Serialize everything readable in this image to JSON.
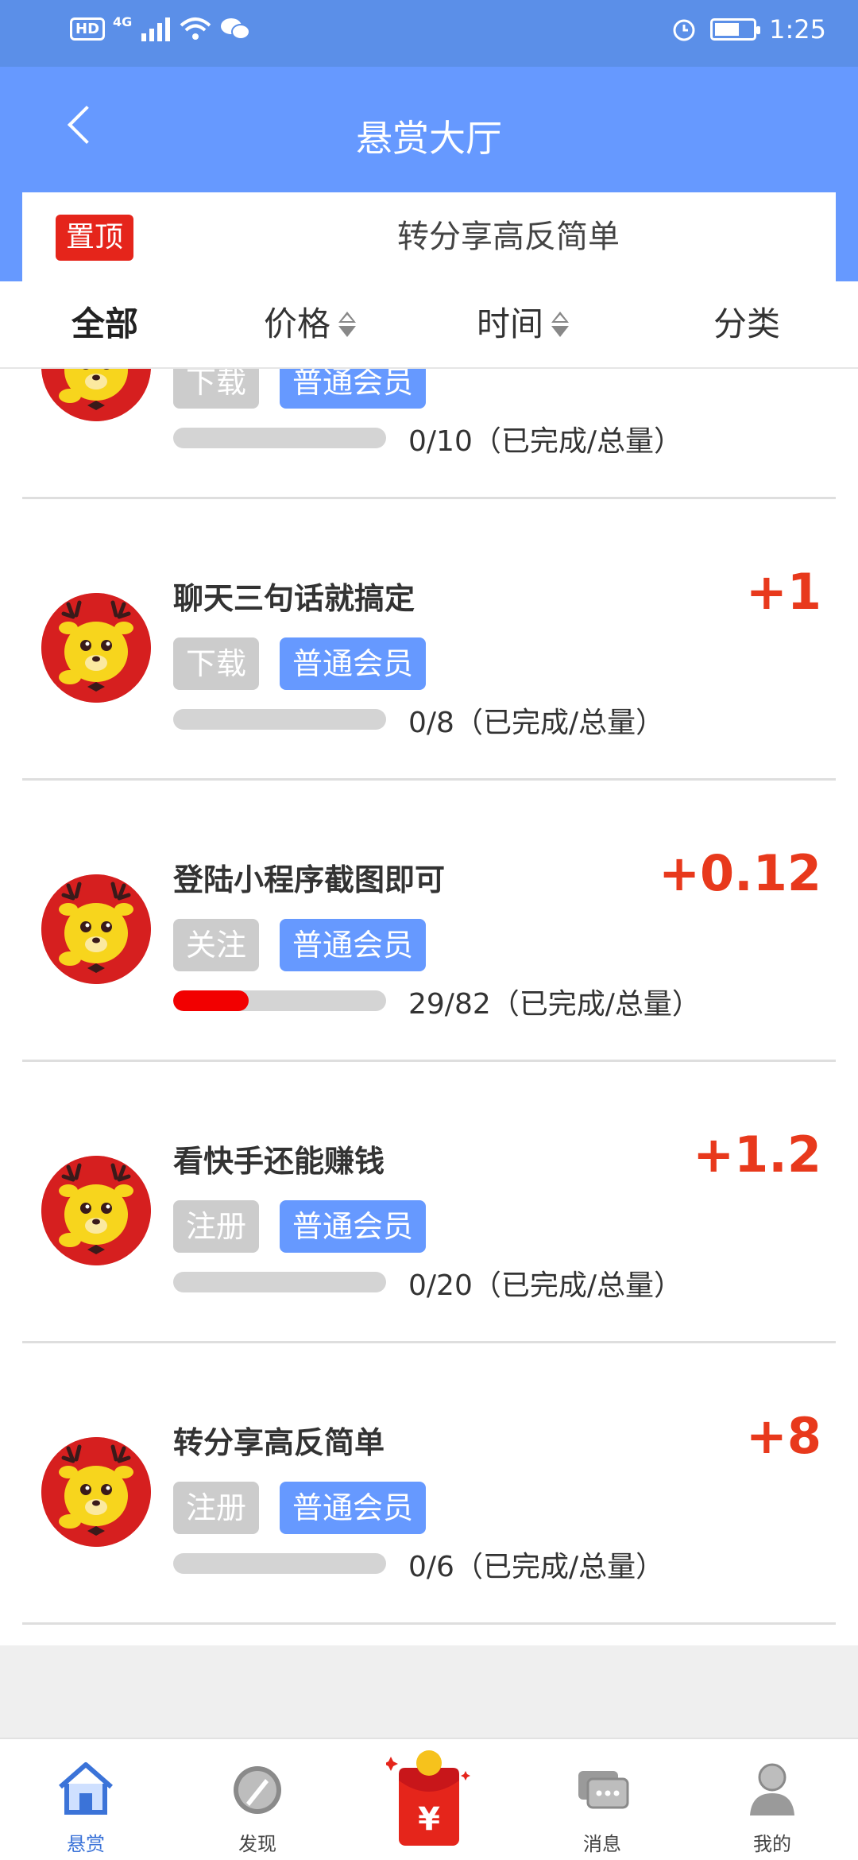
{
  "status_bar": {
    "time": "1:25",
    "network": "4G",
    "hd": "HD"
  },
  "header": {
    "title": "悬赏大厅"
  },
  "banner": {
    "pin_label": "置顶",
    "text": "转分享高反简单"
  },
  "filters": [
    {
      "label": "全部",
      "active": true
    },
    {
      "label": "价格",
      "sortable": true
    },
    {
      "label": "时间",
      "sortable": true
    },
    {
      "label": "分类"
    }
  ],
  "tasks": [
    {
      "title": "",
      "reward": "",
      "tags": [
        "下载",
        "普通会员"
      ],
      "progress": 0,
      "progress_text": "0/10（已完成/总量）"
    },
    {
      "title": "聊天三句话就搞定",
      "reward": "+1",
      "tags": [
        "下载",
        "普通会员"
      ],
      "progress": 0,
      "progress_text": "0/8（已完成/总量）"
    },
    {
      "title": "登陆小程序截图即可",
      "reward": "+0.12",
      "tags": [
        "关注",
        "普通会员"
      ],
      "progress": 0.354,
      "progress_text": "29/82（已完成/总量）"
    },
    {
      "title": "看快手还能赚钱",
      "reward": "+1.2",
      "tags": [
        "注册",
        "普通会员"
      ],
      "progress": 0,
      "progress_text": "0/20（已完成/总量）"
    },
    {
      "title": "转分享高反简单",
      "reward": "+8",
      "tags": [
        "注册",
        "普通会员"
      ],
      "progress": 0,
      "progress_text": "0/6（已完成/总量）"
    }
  ],
  "tabbar": [
    {
      "label": "悬赏",
      "icon": "home-icon",
      "active": true
    },
    {
      "label": "发现",
      "icon": "compass-icon"
    },
    {
      "label": "",
      "icon": "red-packet-icon"
    },
    {
      "label": "消息",
      "icon": "message-icon"
    },
    {
      "label": "我的",
      "icon": "profile-icon"
    }
  ],
  "colors": {
    "primary": "#6699ff",
    "status_bar": "#5b8fe8",
    "reward": "#e8391c",
    "pin": "#e5251b",
    "progress": "#f20000"
  }
}
